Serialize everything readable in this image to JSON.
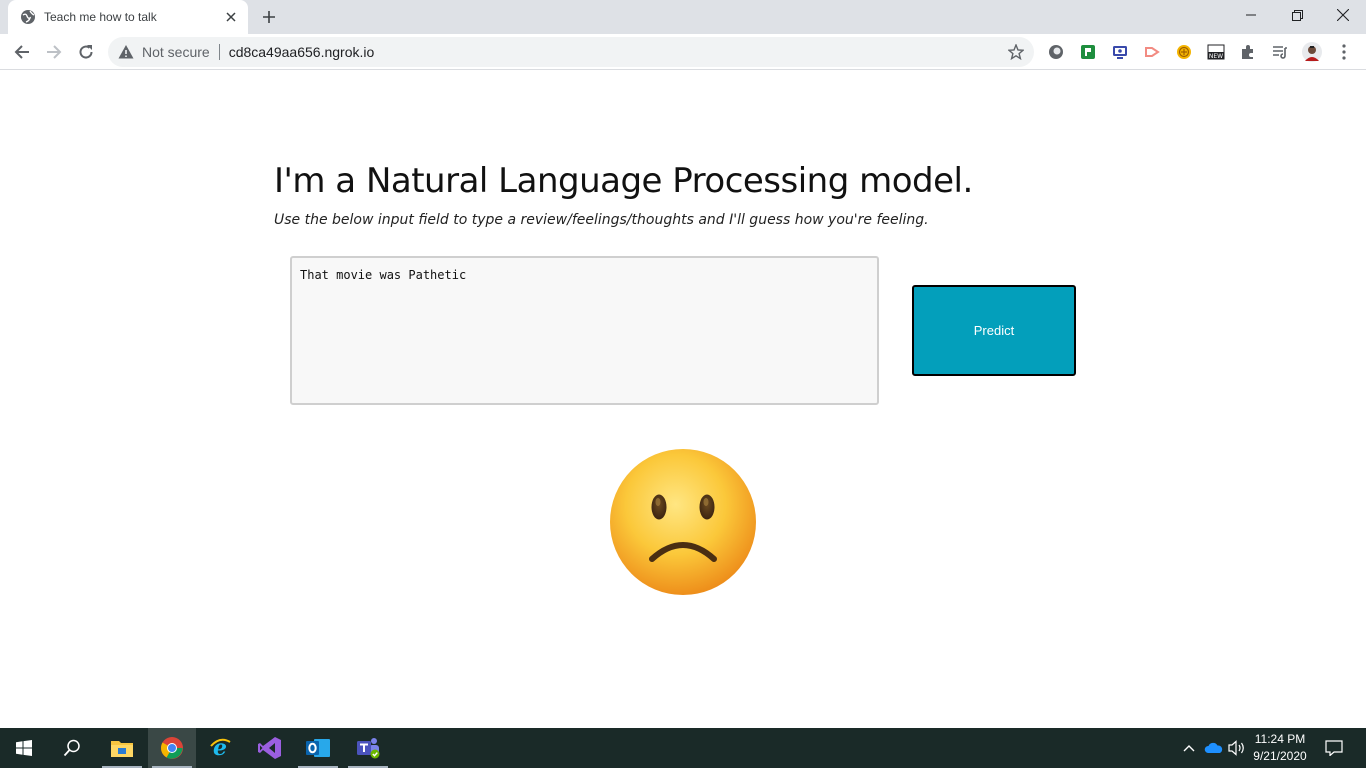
{
  "browser": {
    "tab": {
      "title": "Teach me how to talk",
      "favicon": "globe-icon"
    },
    "address_bar": {
      "security_label": "Not secure",
      "url": "cd8ca49aa656.ngrok.io"
    },
    "extensions": [
      "extension-icon",
      "spreadsheet-extension-icon",
      "screen-extension-icon",
      "arrow-extension-icon",
      "coin-extension-icon",
      "news-extension-icon",
      "puzzle-icon",
      "playlist-icon",
      "profile-avatar"
    ]
  },
  "page": {
    "headline": "I'm a Natural Language Processing model.",
    "subline": "Use the below input field to type a review/feelings/thoughts and I'll guess how you're feeling.",
    "review_input": {
      "value": "That movie was Pathetic"
    },
    "predict_label": "Predict",
    "result_emoji": "slightly-frowning-face"
  },
  "taskbar": {
    "apps": [
      "start",
      "search",
      "file-explorer",
      "chrome",
      "internet-explorer",
      "visual-studio",
      "outlook",
      "teams"
    ],
    "active_app": "chrome",
    "clock": {
      "time": "11:24 PM",
      "date": "9/21/2020"
    }
  },
  "colors": {
    "predict_button": "#039fbb",
    "taskbar": "#1a2a28",
    "tabstrip": "#dee1e6"
  }
}
